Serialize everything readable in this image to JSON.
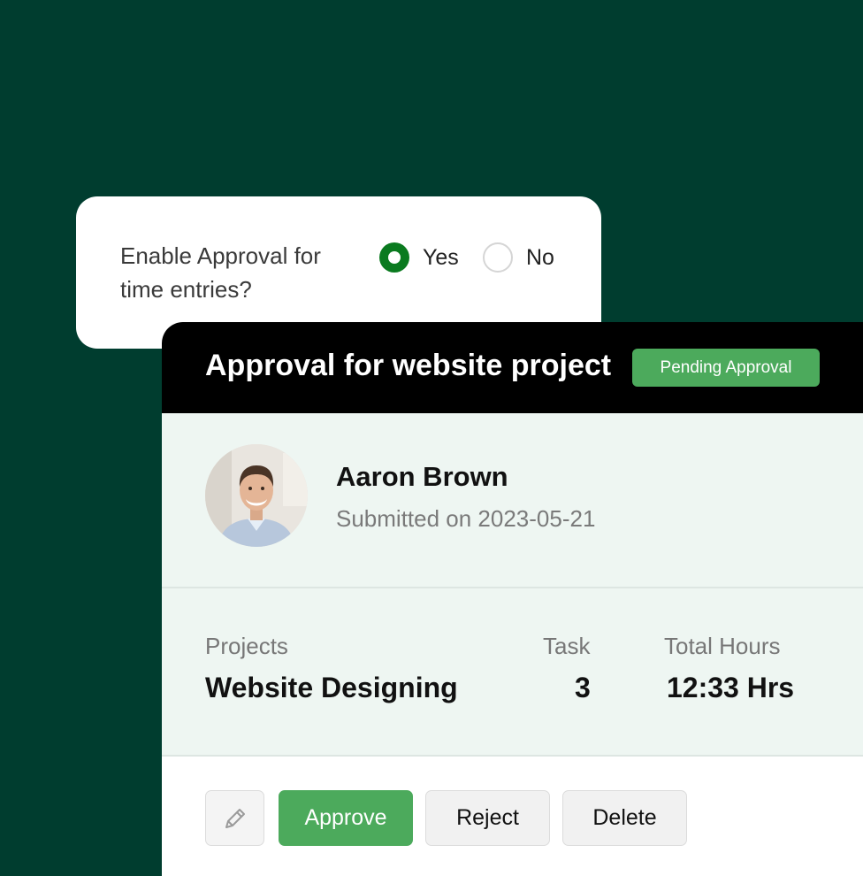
{
  "settings": {
    "question": "Enable Approval for time entries?",
    "options": [
      {
        "label": "Yes",
        "selected": true
      },
      {
        "label": "No",
        "selected": false
      }
    ]
  },
  "approval": {
    "title": "Approval for website project",
    "status": "Pending Approval",
    "user": {
      "name": "Aaron Brown",
      "submitted": "Submitted on 2023-05-21"
    },
    "details": {
      "projects_label": "Projects",
      "projects_value": "Website Designing",
      "task_label": "Task",
      "task_value": "3",
      "hours_label": "Total Hours",
      "hours_value": "12:33 Hrs"
    },
    "actions": {
      "approve_label": "Approve",
      "reject_label": "Reject",
      "delete_label": "Delete"
    }
  },
  "colors": {
    "background": "#003d2f",
    "accent_green": "#4caa5c",
    "radio_selected": "#0a7a1f",
    "panel_tint": "#eef6f2"
  },
  "icons": {
    "edit": "pencil-icon"
  }
}
